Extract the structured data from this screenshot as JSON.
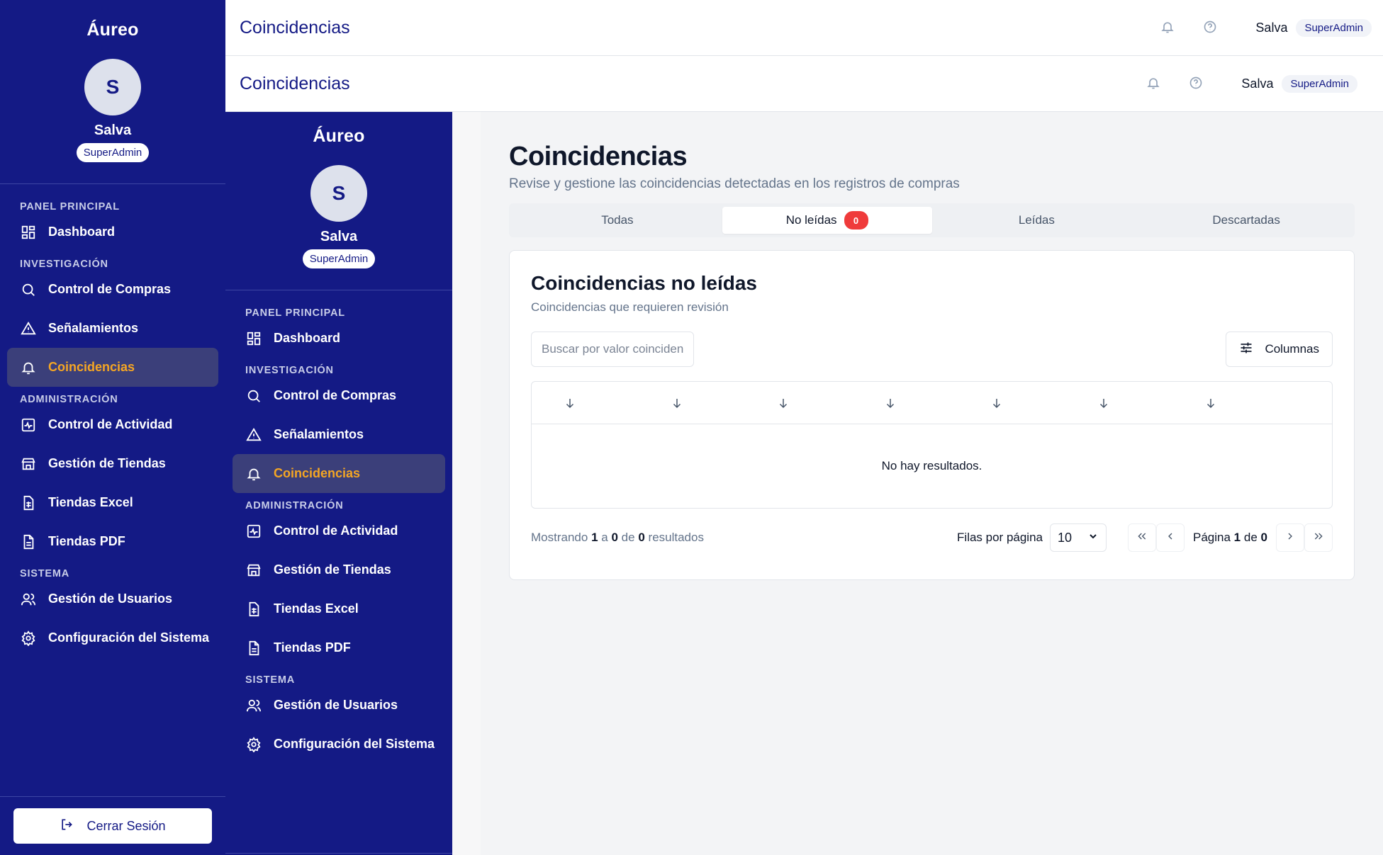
{
  "app": {
    "brand": "Áureo"
  },
  "user": {
    "initial": "S",
    "name": "Salva",
    "role": "SuperAdmin"
  },
  "topbar": {
    "title": "Coincidencias",
    "user": "Salva",
    "role": "SuperAdmin"
  },
  "sidebar": {
    "sections": {
      "panel": "PANEL PRINCIPAL",
      "investigacion": "INVESTIGACIÓN",
      "administracion": "ADMINISTRACIÓN",
      "sistema": "SISTEMA"
    },
    "items": {
      "dashboard": "Dashboard",
      "compras": "Control de Compras",
      "senalamientos": "Señalamientos",
      "coincidencias": "Coincidencias",
      "actividad": "Control de Actividad",
      "tiendas": "Gestión de Tiendas",
      "excel": "Tiendas Excel",
      "pdf": "Tiendas PDF",
      "usuarios": "Gestión de Usuarios",
      "config": "Configuración del Sistema"
    },
    "logout": "Cerrar Sesión"
  },
  "page": {
    "title": "Coincidencias",
    "subtitle": "Revise y gestione las coincidencias detectadas en los registros de compras"
  },
  "tabs": {
    "todas": "Todas",
    "no_leidas": "No leídas",
    "no_leidas_count": "0",
    "leidas": "Leídas",
    "descartadas": "Descartadas"
  },
  "card": {
    "title": "Coincidencias no leídas",
    "subtitle": "Coincidencias que requieren revisión",
    "search_placeholder": "Buscar por valor coincidente...",
    "columns_label": "Columnas",
    "empty": "No hay resultados."
  },
  "footer": {
    "showing_prefix": "Mostrando",
    "from": "1",
    "to_word": "a",
    "to": "0",
    "of_word": "de",
    "total": "0",
    "results_word": "resultados",
    "rows_label": "Filas por página",
    "rows_value": "10",
    "page_word": "Página",
    "page": "1",
    "pages": "0"
  },
  "colors": {
    "sidebar_bg": "#141a85",
    "active_text": "#f5a623",
    "badge": "#ef3b3b"
  }
}
